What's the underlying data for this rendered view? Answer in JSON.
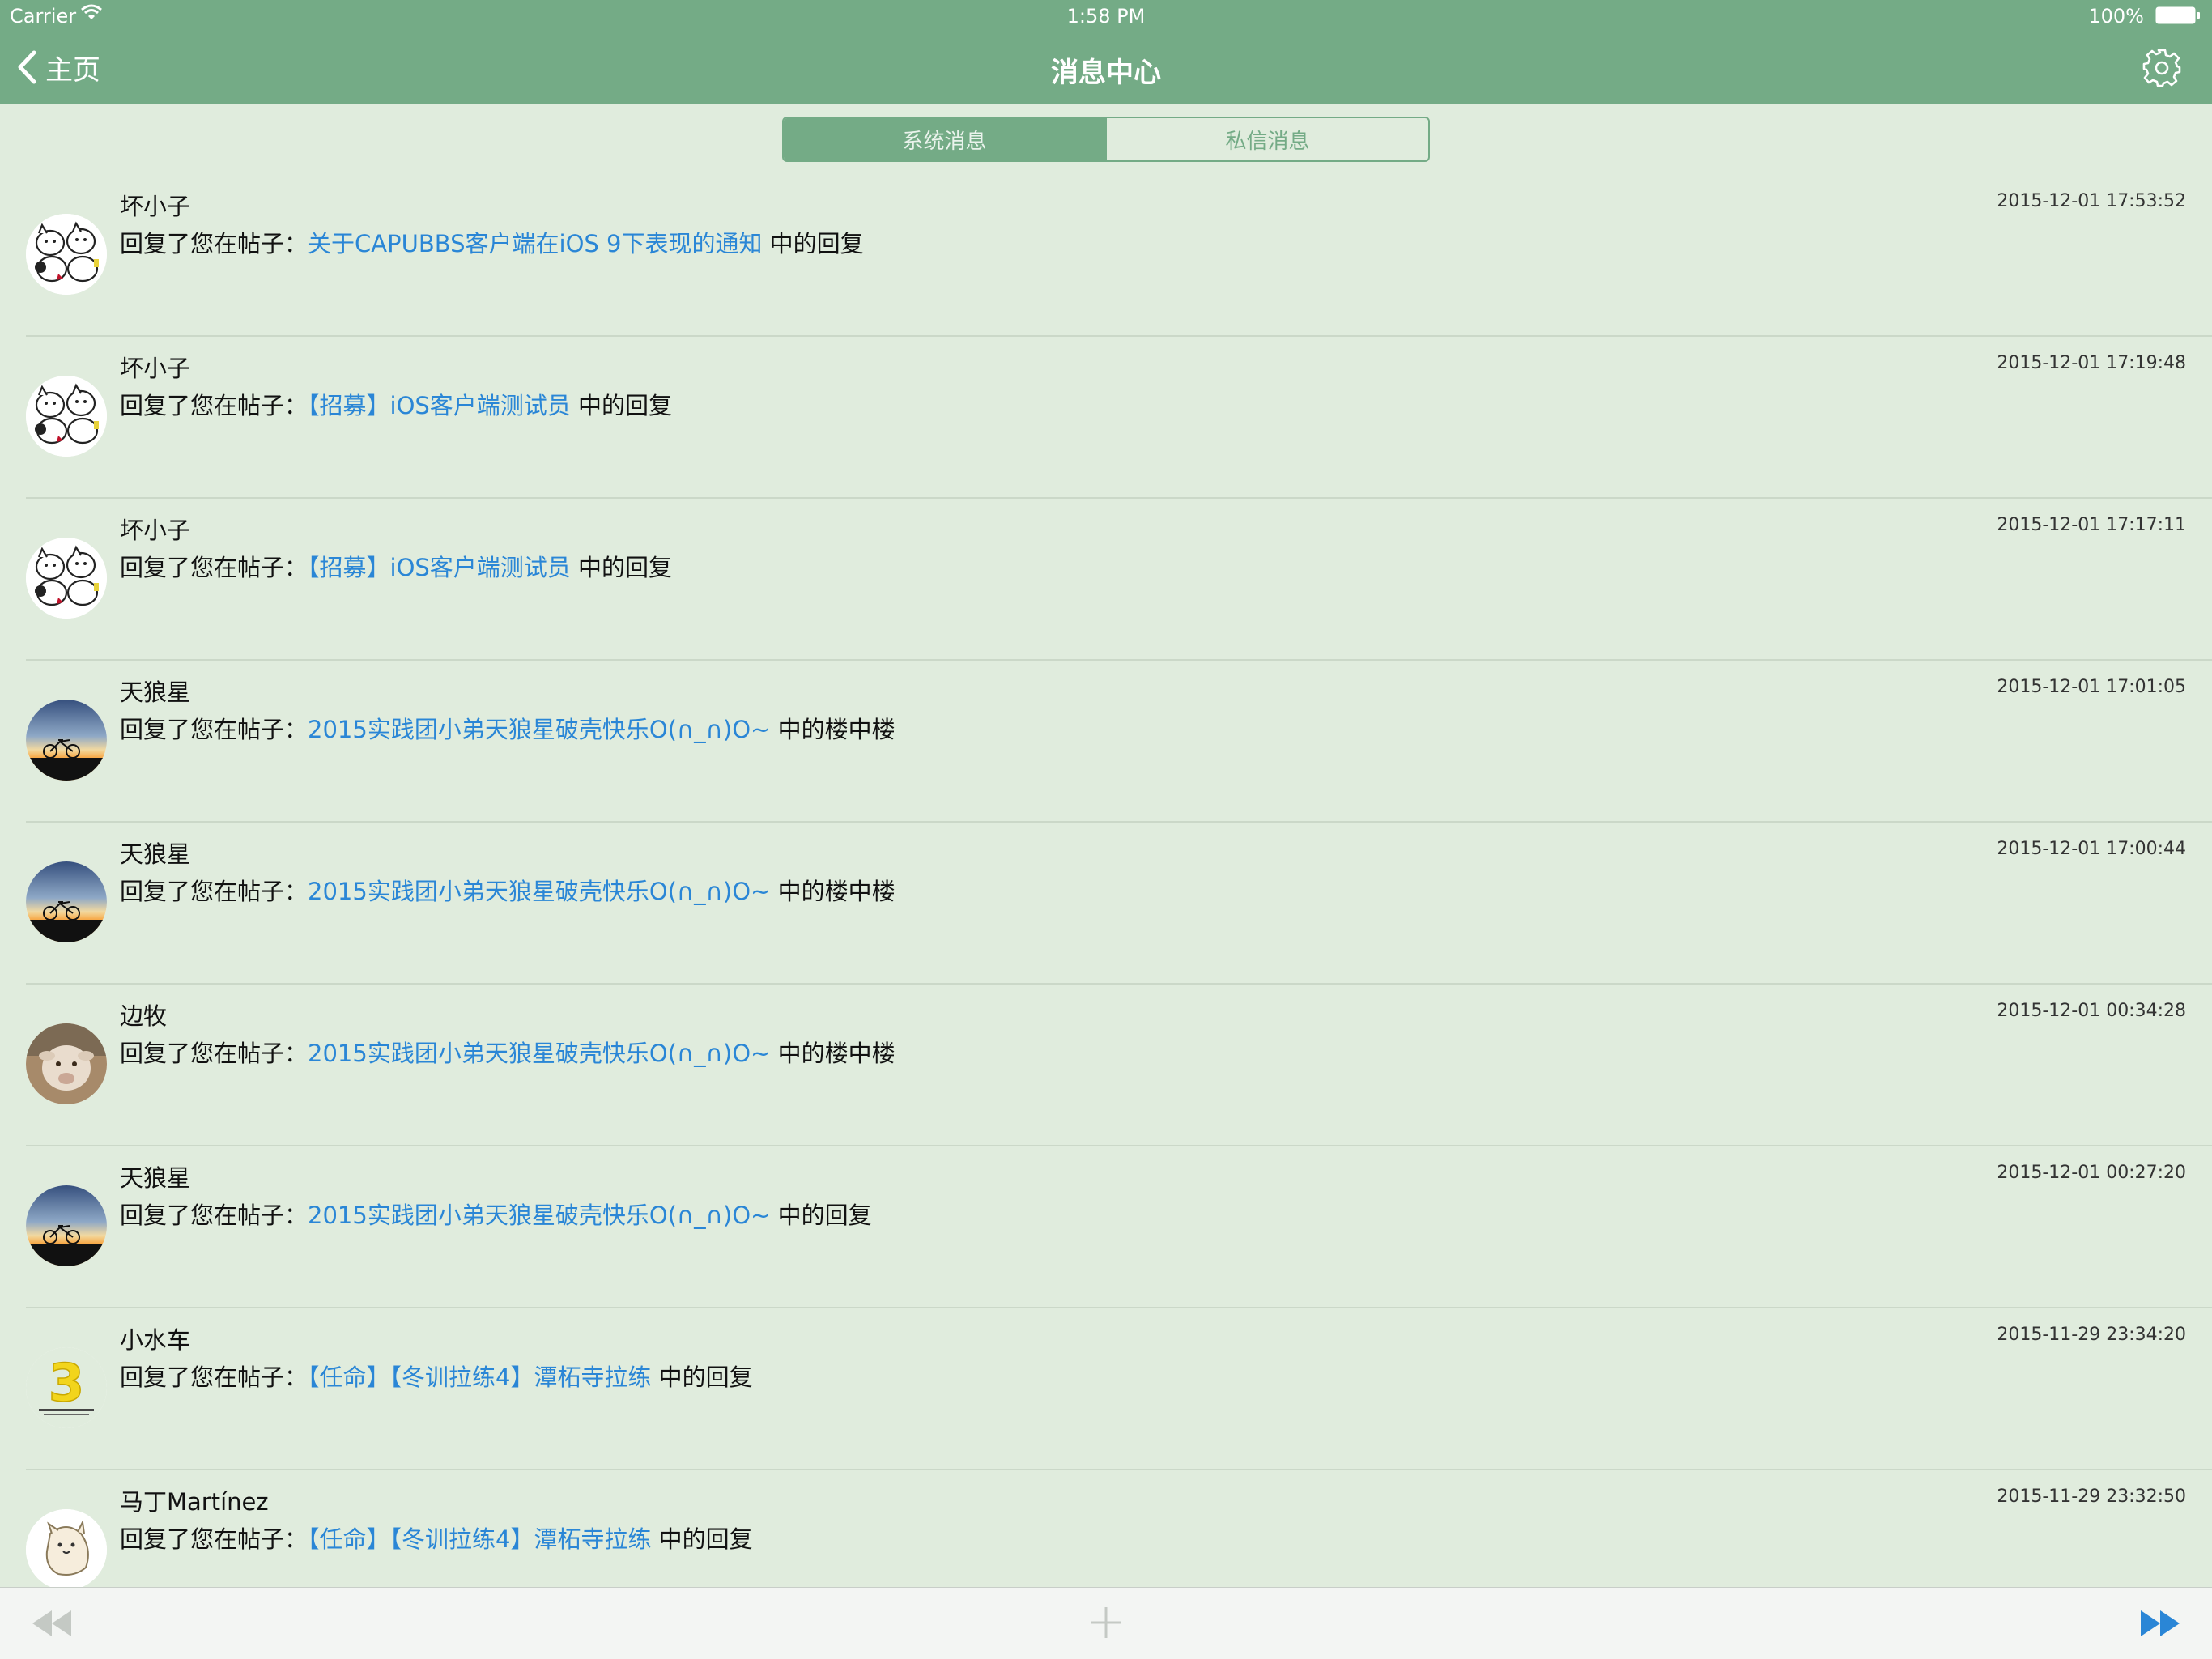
{
  "status_bar": {
    "carrier": "Carrier",
    "time": "1:58 PM",
    "battery": "100%"
  },
  "nav": {
    "back_label": "主页",
    "title": "消息中心",
    "settings_icon": "gear-icon"
  },
  "segments": {
    "items": [
      "系统消息",
      "私信消息"
    ],
    "selected": 0
  },
  "messages": [
    {
      "user": "坏小子",
      "avatar": "cartoon-animals",
      "prefix": "回复了您在帖子：",
      "post": "关于CAPUBBS客户端在iOS 9下表现的通知",
      "suffix": " 中的回复",
      "time": "2015-12-01 17:53:52"
    },
    {
      "user": "坏小子",
      "avatar": "cartoon-animals",
      "prefix": "回复了您在帖子：",
      "post": "【招募】iOS客户端测试员",
      "suffix": " 中的回复",
      "time": "2015-12-01 17:19:48"
    },
    {
      "user": "坏小子",
      "avatar": "cartoon-animals",
      "prefix": "回复了您在帖子：",
      "post": "【招募】iOS客户端测试员",
      "suffix": " 中的回复",
      "time": "2015-12-01 17:17:11"
    },
    {
      "user": "天狼星",
      "avatar": "sunset-bicycle",
      "prefix": "回复了您在帖子：",
      "post": "2015实践团小弟天狼星破壳快乐O(∩_∩)O~",
      "suffix": " 中的楼中楼",
      "time": "2015-12-01 17:01:05"
    },
    {
      "user": "天狼星",
      "avatar": "sunset-bicycle",
      "prefix": "回复了您在帖子：",
      "post": "2015实践团小弟天狼星破壳快乐O(∩_∩)O~",
      "suffix": " 中的楼中楼",
      "time": "2015-12-01 17:00:44"
    },
    {
      "user": "边牧",
      "avatar": "sheep",
      "prefix": "回复了您在帖子：",
      "post": "2015实践团小弟天狼星破壳快乐O(∩_∩)O~",
      "suffix": " 中的楼中楼",
      "time": "2015-12-01 00:34:28"
    },
    {
      "user": "天狼星",
      "avatar": "sunset-bicycle",
      "prefix": "回复了您在帖子：",
      "post": "2015实践团小弟天狼星破壳快乐O(∩_∩)O~",
      "suffix": " 中的回复",
      "time": "2015-12-01 00:27:20"
    },
    {
      "user": "小水车",
      "avatar": "number-3",
      "prefix": "回复了您在帖子：",
      "post": "【任命】【冬训拉练4】潭柘寺拉练",
      "suffix": " 中的回复",
      "time": "2015-11-29 23:34:20"
    },
    {
      "user": "马丁Martínez",
      "avatar": "cartoon-creature",
      "prefix": "回复了您在帖子：",
      "post": "【任命】【冬训拉练4】潭柘寺拉练",
      "suffix": " 中的回复",
      "time": "2015-11-29 23:32:50"
    }
  ],
  "toolbar": {
    "first_icon": "rewind-icon",
    "add_icon": "plus-icon",
    "last_icon": "fast-forward-icon"
  },
  "colors": {
    "nav": "#74ab86",
    "background": "#e0ecdd",
    "link": "#2a86d6",
    "toolbar": "#f3f5f3"
  }
}
